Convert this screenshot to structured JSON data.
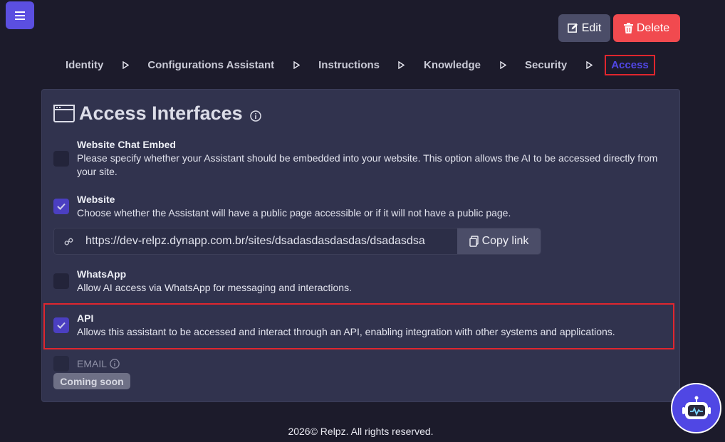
{
  "header": {
    "menu_icon": "hamburger-icon",
    "edit_label": "Edit",
    "delete_label": "Delete"
  },
  "steps": [
    {
      "label": "Identity"
    },
    {
      "label": "Configurations Assistant"
    },
    {
      "label": "Instructions"
    },
    {
      "label": "Knowledge"
    },
    {
      "label": "Security"
    },
    {
      "label": "Access"
    }
  ],
  "card": {
    "title": "Access Interfaces",
    "options": {
      "embed": {
        "title": "Website Chat Embed",
        "desc": "Please specify whether your Assistant should be embedded into your website. This option allows the AI to be accessed directly from your site.",
        "checked": false
      },
      "website": {
        "title": "Website",
        "desc": "Choose whether the Assistant will have a public page accessible or if it will not have a public page.",
        "checked": true
      },
      "whatsapp": {
        "title": "WhatsApp",
        "desc": "Allow AI access via WhatsApp for messaging and interactions.",
        "checked": false
      },
      "api": {
        "title": "API",
        "desc": "Allows this assistant to be accessed and interact through an API, enabling integration with other systems and applications.",
        "checked": true
      }
    },
    "link": {
      "url": "https://dev-relpz.dynapp.com.br/sites/dsadasdasdasdas/dsadasdsa",
      "copy_label": "Copy link"
    },
    "email": {
      "label": "EMAIL",
      "badge": "Coming soon"
    }
  },
  "footer": {
    "text": "2026© Relpz. All rights reserved."
  },
  "colors": {
    "accent": "#5047e4",
    "danger": "#f14a4f",
    "highlight": "#e0262e"
  }
}
